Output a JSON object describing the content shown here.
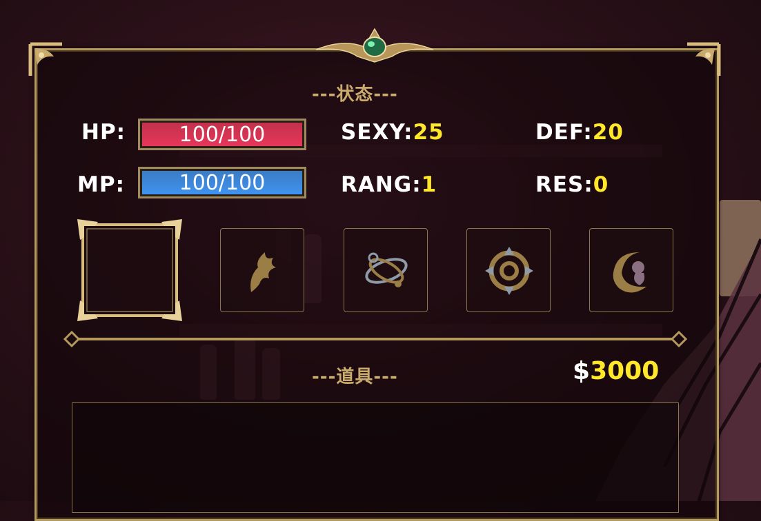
{
  "status_panel": {
    "title": "---状态---",
    "hp": {
      "label": "HP:",
      "text": "100/100",
      "current": 100,
      "max": 100,
      "color": "#e8365a"
    },
    "mp": {
      "label": "MP:",
      "text": "100/100",
      "current": 100,
      "max": 100,
      "color": "#3f93f0"
    },
    "sexy": {
      "label": "SEXY:",
      "value": "25"
    },
    "rang": {
      "label": "RANG:",
      "value": "1"
    },
    "def": {
      "label": "DEF:",
      "value": "20"
    },
    "res": {
      "label": "RES:",
      "value": "0"
    }
  },
  "skill_slots": [
    {
      "icon": "empty-slot",
      "selected": true
    },
    {
      "icon": "flame-crest-icon"
    },
    {
      "icon": "orbit-rings-icon"
    },
    {
      "icon": "target-compass-icon"
    },
    {
      "icon": "embryo-moon-icon"
    }
  ],
  "items_panel": {
    "title": "---道具---",
    "currency_symbol": "$",
    "money": "3000"
  },
  "colors": {
    "gold": "#c9ab6e",
    "value_yellow": "#ffe82a",
    "frame": "#b59a5f"
  }
}
